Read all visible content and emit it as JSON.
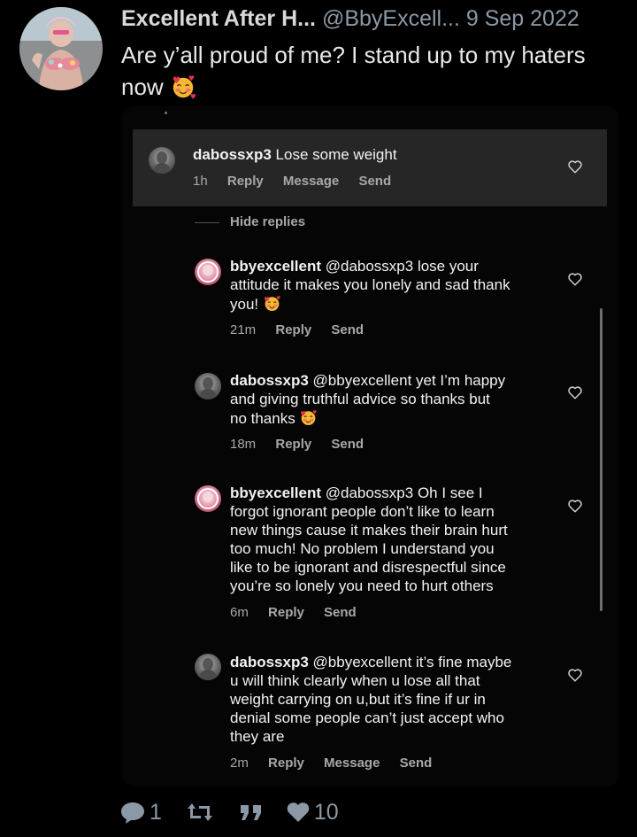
{
  "tweet": {
    "display_name": "Excellent After H...",
    "handle": "@BbyExcell...",
    "date": "9 Sep 2022",
    "text": "Are y’all proud of me? I stand up to my haters now",
    "emoji": "smiling-face-with-hearts"
  },
  "screenshot": {
    "main_comment": {
      "user": "dabossxp3",
      "text": "Lose some weight",
      "time": "1h",
      "actions": [
        "Reply",
        "Message",
        "Send"
      ]
    },
    "hide_replies": "Hide replies",
    "replies": [
      {
        "user": "bbyexcellent",
        "lines": [
          "@dabossxp3 lose your",
          "attitude it makes you lonely and sad thank",
          "you!"
        ],
        "time": "21m",
        "actions": [
          "Reply",
          "Send"
        ],
        "emoji": "smiling-face-with-hearts"
      },
      {
        "user": "dabossxp3",
        "lines": [
          "@bbyexcellent yet I’m happy",
          "and giving truthful advice so thanks but",
          "no thanks"
        ],
        "time": "18m",
        "actions": [
          "Reply",
          "Send"
        ],
        "emoji": "smiling-face-with-hearts"
      },
      {
        "user": "bbyexcellent",
        "lines": [
          "@dabossxp3  Oh I see I",
          "forgot ignorant people don’t like to learn",
          "new things cause it makes their brain hurt",
          "too much! No problem I understand you",
          "like to be ignorant and disrespectful since",
          "you’re so lonely you need to hurt others"
        ],
        "time": "6m",
        "actions": [
          "Reply",
          "Send"
        ]
      },
      {
        "user": "dabossxp3",
        "lines": [
          "@bbyexcellent it’s fine maybe",
          "u will think clearly when u lose all that",
          "weight carrying on u,but it’s fine if ur in",
          "denial some people can’t just accept who",
          "they are"
        ],
        "time": "2m",
        "actions": [
          "Reply",
          "Message",
          "Send"
        ]
      }
    ]
  },
  "action_bar": {
    "replies": "1",
    "retweets": "",
    "quotes": "",
    "likes": "10"
  },
  "colors": {
    "background": "#000000",
    "muted": "#8b98a5",
    "comment_highlight": "#262626"
  }
}
